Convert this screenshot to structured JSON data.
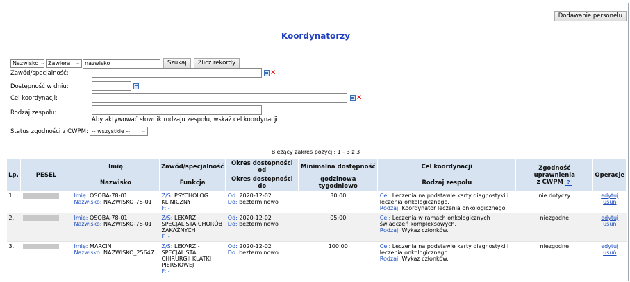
{
  "toolbar": {
    "add_personnel": "Dodawanie personelu"
  },
  "page_title": "Koordynatorzy",
  "search": {
    "field_select": "Nazwisko",
    "mode_select": "Zawiera",
    "value": "nazwisko",
    "search_button": "Szukaj",
    "count_button": "Zlicz rekordy"
  },
  "filters": {
    "profession_label": "Zawód/specjalność:",
    "availability_label": "Dostępność w dniu:",
    "goal_label": "Cel koordynacji:",
    "team_type_label": "Rodzaj zespołu:",
    "team_type_hint": "Aby aktywować słownik rodzaju zespołu, wskaż cel koordynacji",
    "cwpm_label": "Status zgodności z CWPM:",
    "cwpm_value": "-- wszystkie --"
  },
  "range_text": "Bieżący zakres pozycji: 1 - 3 z 3",
  "table": {
    "headers": {
      "lp": "Lp.",
      "pesel": "PESEL",
      "imie": "Imię",
      "nazwisko": "Nazwisko",
      "zawod": "Zawód/specjalność",
      "funkcja": "Funkcja",
      "okres1": "Okres dostępności od",
      "okres2": "Okres dostępności do",
      "min1": "Minimalna dostępność",
      "min2": "godzinowa tygodniowo",
      "cel": "Cel koordynacji",
      "rodzaj": "Rodzaj zespołu",
      "zgod1": "Zgodność uprawnienia",
      "zgod2": "z CWPM",
      "help": "?",
      "operacje": "Operacje"
    },
    "rows": [
      {
        "lp": "1.",
        "imie_label": "Imię:",
        "imie": "OSOBA-78-01",
        "nazwisko_label": "Nazwisko:",
        "nazwisko": "NAZWISKO-78-01",
        "zs_label": "Z/S:",
        "zs": "PSYCHOLOG KLINICZNY",
        "f_label": "F:",
        "f": "-",
        "od_label": "Od:",
        "od": "2020-12-02",
        "do_label": "Do:",
        "do": "bezterminowo",
        "min": "30:00",
        "cel_label": "Cel:",
        "cel": "Leczenia na podstawie karty diagnostyki i leczenia onkologicznego.",
        "rodzaj_label": "Rodzaj:",
        "rodzaj": "Koordynator leczenia onkologicznego.",
        "zgodnosc": "nie dotyczy",
        "edit": "edytuj",
        "del": "usuń"
      },
      {
        "lp": "2.",
        "imie_label": "Imię:",
        "imie": "OSOBA-78-01",
        "nazwisko_label": "Nazwisko:",
        "nazwisko": "NAZWISKO-78-01",
        "zs_label": "Z/S:",
        "zs": "LEKARZ - SPECJALISTA CHORÓB ZAKAŹNYCH",
        "f_label": "F:",
        "f": "-",
        "od_label": "Od:",
        "od": "2020-12-02",
        "do_label": "Do:",
        "do": "bezterminowo",
        "min": "05:00",
        "cel_label": "Cel:",
        "cel": "Leczenia w ramach onkologicznych świadczeń kompleksowych.",
        "rodzaj_label": "Rodzaj:",
        "rodzaj": "Wykaz członków.",
        "zgodnosc": "niezgodne",
        "edit": "edytuj",
        "del": "usuń"
      },
      {
        "lp": "3.",
        "imie_label": "Imię:",
        "imie": "MARCIN",
        "nazwisko_label": "Nazwisko:",
        "nazwisko": "NAZWISKO_25647",
        "zs_label": "Z/S:",
        "zs": "LEKARZ - SPECJALISTA CHIRURGII KLATKI PIERSIOWEJ",
        "f_label": "F:",
        "f": "-",
        "od_label": "Od:",
        "od": "2020-12-02",
        "do_label": "Do:",
        "do": "bezterminowo",
        "min": "100:00",
        "cel_label": "Cel:",
        "cel": "Leczenia na podstawie karty diagnostyki i leczenia onkologicznego.",
        "rodzaj_label": "Rodzaj:",
        "rodzaj": "Wykaz członków.",
        "zgodnosc": "niezgodne",
        "edit": "edytuj",
        "del": "usuń"
      }
    ]
  }
}
